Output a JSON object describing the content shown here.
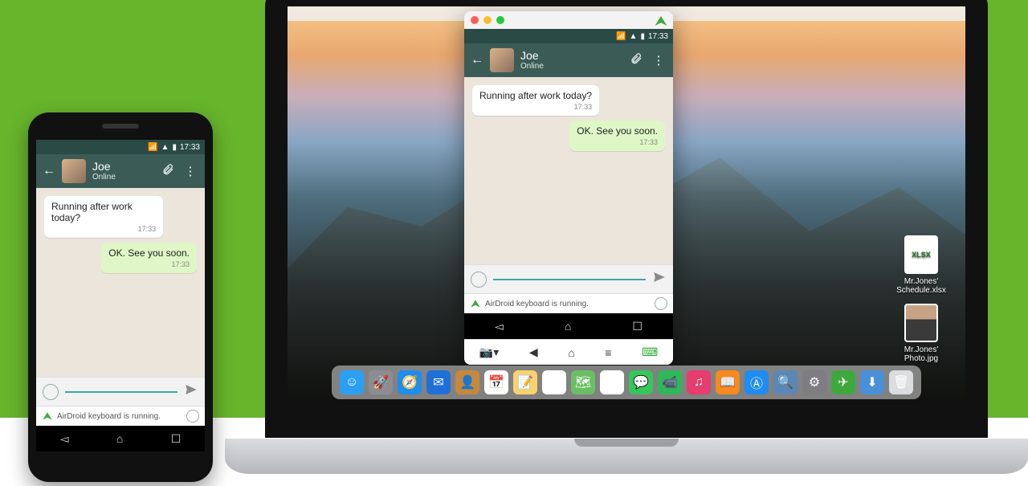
{
  "status": {
    "time": "17:33"
  },
  "chat": {
    "contact_name": "Joe",
    "contact_status": "Online",
    "messages": [
      {
        "text": "Running after work today?",
        "time": "17:33",
        "side": "out"
      },
      {
        "text": "OK. See you soon.",
        "time": "17:33",
        "side": "in"
      }
    ]
  },
  "keyboard_banner": "AirDroid keyboard is running.",
  "desktop_files": {
    "xlsx_badge": "XLSX",
    "file1": "Mr.Jones' Schedule.xlsx",
    "file2": "Mr.Jones' Photo.jpg"
  },
  "dock_icons": [
    {
      "name": "finder-icon",
      "bg": "#2aa0f5",
      "glyph": "☺"
    },
    {
      "name": "launchpad-icon",
      "bg": "#8c8c91",
      "glyph": "🚀"
    },
    {
      "name": "safari-icon",
      "bg": "#1e8cf0",
      "glyph": "🧭"
    },
    {
      "name": "mail-icon",
      "bg": "#1f6fd8",
      "glyph": "✉"
    },
    {
      "name": "contacts-icon",
      "bg": "#c6893c",
      "glyph": "👤"
    },
    {
      "name": "calendar-icon",
      "bg": "#ffffff",
      "glyph": "📅"
    },
    {
      "name": "notes-icon",
      "bg": "#f9d26b",
      "glyph": "📝"
    },
    {
      "name": "reminders-icon",
      "bg": "#ffffff",
      "glyph": "☑"
    },
    {
      "name": "maps-icon",
      "bg": "#6abf64",
      "glyph": "🗺"
    },
    {
      "name": "photos-icon",
      "bg": "#ffffff",
      "glyph": "✿"
    },
    {
      "name": "messages-icon",
      "bg": "#35c759",
      "glyph": "💬"
    },
    {
      "name": "facetime-icon",
      "bg": "#2fb85a",
      "glyph": "📹"
    },
    {
      "name": "itunes-icon",
      "bg": "#e63c6e",
      "glyph": "♫"
    },
    {
      "name": "ibooks-icon",
      "bg": "#f58a1f",
      "glyph": "📖"
    },
    {
      "name": "appstore-icon",
      "bg": "#1e8cf0",
      "glyph": "Ⓐ"
    },
    {
      "name": "preview-icon",
      "bg": "#5b87b5",
      "glyph": "🔍"
    },
    {
      "name": "systemprefs-icon",
      "bg": "#7d7d82",
      "glyph": "⚙"
    },
    {
      "name": "airdroid-icon",
      "bg": "#3da93d",
      "glyph": "✈"
    },
    {
      "name": "downloads-icon",
      "bg": "#4a90d9",
      "glyph": "⬇"
    },
    {
      "name": "trash-icon",
      "bg": "#dcdde0",
      "glyph": "🗑"
    }
  ]
}
